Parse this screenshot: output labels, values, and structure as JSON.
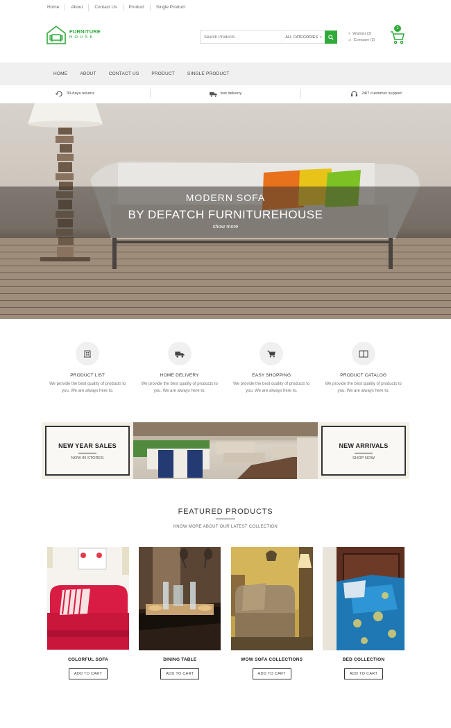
{
  "top_links": [
    "Home",
    "About",
    "Contact Us",
    "Product",
    "Single Product"
  ],
  "logo": {
    "line1": "FURNITURE",
    "line2": "HOUSE"
  },
  "search": {
    "placeholder": "Search Products",
    "category": "ALL CATEGORIES"
  },
  "header_links": {
    "wishlist": "Wishlist (3)",
    "compare": "Compare (2)"
  },
  "cart": {
    "count": "2"
  },
  "nav": [
    "HOME",
    "ABOUT",
    "CONTACT US",
    "PRODUCT",
    "SINGLE PRODUCT"
  ],
  "strip": [
    {
      "icon": "return-icon",
      "label": "30-days returns"
    },
    {
      "icon": "truck-icon",
      "label": "fast delivery"
    },
    {
      "icon": "headset-icon",
      "label": "24/7 customer support"
    }
  ],
  "hero": {
    "title": "MODERN SOFA",
    "subtitle": "BY DEFATCH FURNITUREHOUSE",
    "link": "show more"
  },
  "services": [
    {
      "icon": "building-icon",
      "title": "PRODUCT LIST",
      "desc": "We provide the best quality of products to you. We are always here to."
    },
    {
      "icon": "truck-icon",
      "title": "HOME DELIVERY",
      "desc": "We provide the best quality of products to you. We are always here to."
    },
    {
      "icon": "cart-icon",
      "title": "EASY SHOPPING",
      "desc": "We provide the best quality of products to you. We are always here to."
    },
    {
      "icon": "book-icon",
      "title": "PRODUCT CATALOG",
      "desc": "We provide the best quality of products to you. We are always here to."
    }
  ],
  "banner": {
    "left": {
      "heading": "NEW YEAR SALES",
      "sub": "NOW IN STORES"
    },
    "right": {
      "heading": "NEW ARRIVALS",
      "sub": "SHOP NOW"
    }
  },
  "featured": {
    "title": "FEATURED PRODUCTS",
    "subtitle": "KNOW MORE ABOUT OUR LATEST COLLECTION"
  },
  "products": [
    {
      "name": "COLORFUL SOFA",
      "button": "ADD TO CART"
    },
    {
      "name": "DINING TABLE",
      "button": "ADD TO CART"
    },
    {
      "name": "WOW SOFA COLLECTIONS",
      "button": "ADD TO CART"
    },
    {
      "name": "BED COLLECTION",
      "button": "ADD TO CART"
    }
  ],
  "colors": {
    "accent": "#2faa3b"
  }
}
